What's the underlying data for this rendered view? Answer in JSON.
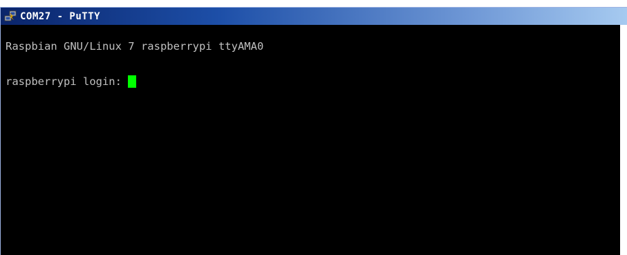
{
  "window": {
    "title": "COM27 - PuTTY"
  },
  "terminal": {
    "line1": "Raspbian GNU/Linux 7 raspberrypi ttyAMA0",
    "prompt": "raspberrypi login: "
  },
  "colors": {
    "titlebar_start": "#0a246a",
    "titlebar_end": "#a6caf0",
    "terminal_bg": "#000000",
    "terminal_fg": "#c0c0c0",
    "cursor": "#00ff00"
  },
  "icons": {
    "app": "putty-icon"
  }
}
